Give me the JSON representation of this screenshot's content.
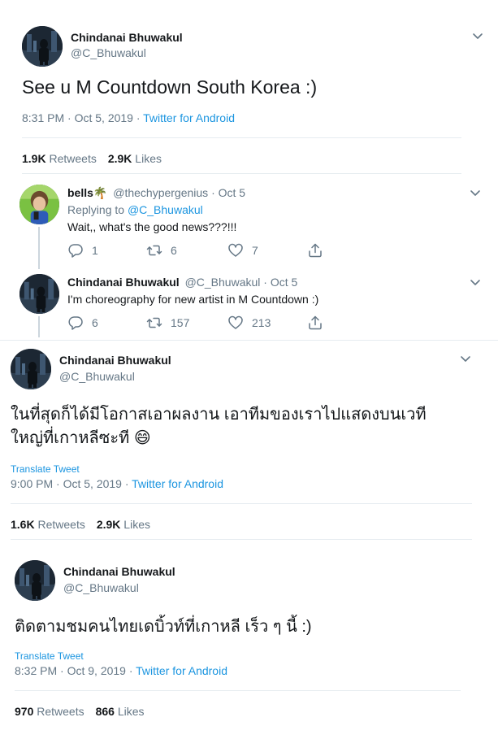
{
  "tweet1": {
    "name": "Chindanai Bhuwakul",
    "handle": "@C_Bhuwakul",
    "text": "See u M Countdown South Korea :)",
    "time": "8:31 PM · Oct 5, 2019 · ",
    "source": "Twitter for Android",
    "retweets_count": "1.9K",
    "retweets_label": "Retweets",
    "likes_count": "2.9K",
    "likes_label": "Likes"
  },
  "reply1": {
    "name": "bells🌴",
    "handle_date": "@thechypergenius · Oct 5",
    "replying_prefix": "Replying to ",
    "replying_handle": "@C_Bhuwakul",
    "text": "Wait,, what's the good news???!!!",
    "replies": "1",
    "retweets": "6",
    "likes": "7"
  },
  "reply2": {
    "name": "Chindanai Bhuwakul",
    "handle_date": "@C_Bhuwakul · Oct 5",
    "text": "I'm choreography for new artist in M Countdown :)",
    "replies": "6",
    "retweets": "157",
    "likes": "213"
  },
  "tweet2": {
    "name": "Chindanai Bhuwakul",
    "handle": "@C_Bhuwakul",
    "text_line1": "ในที่สุดก็ได้มีโอกาสเอาผลงาน เอาทีมของเราไปแสดงบนเวที",
    "text_line2": "ใหญ่ที่เกาหลีซะที 😄",
    "translate": "Translate Tweet",
    "time": "9:00 PM · Oct 5, 2019 · ",
    "source": "Twitter for Android",
    "retweets_count": "1.6K",
    "retweets_label": "Retweets",
    "likes_count": "2.9K",
    "likes_label": "Likes"
  },
  "tweet3": {
    "name": "Chindanai Bhuwakul",
    "handle": "@C_Bhuwakul",
    "text": "ติดตามชมคนไทยเดบิ้วท์ที่เกาหลี เร็ว ๆ นี้ :)",
    "translate": "Translate Tweet",
    "time": "8:32 PM · Oct 9, 2019 · ",
    "source": "Twitter for Android",
    "retweets_count": "970",
    "retweets_label": "Retweets",
    "likes_count": "866",
    "likes_label": "Likes"
  },
  "icons": {
    "reply": "reply-icon",
    "retweet": "retweet-icon",
    "like": "heart-icon",
    "share": "share-icon",
    "more": "chevron-down-icon"
  },
  "colors": {
    "link": "#1b95e0",
    "muted": "#657786",
    "text": "#14171a",
    "divider": "#e6ecf0"
  }
}
